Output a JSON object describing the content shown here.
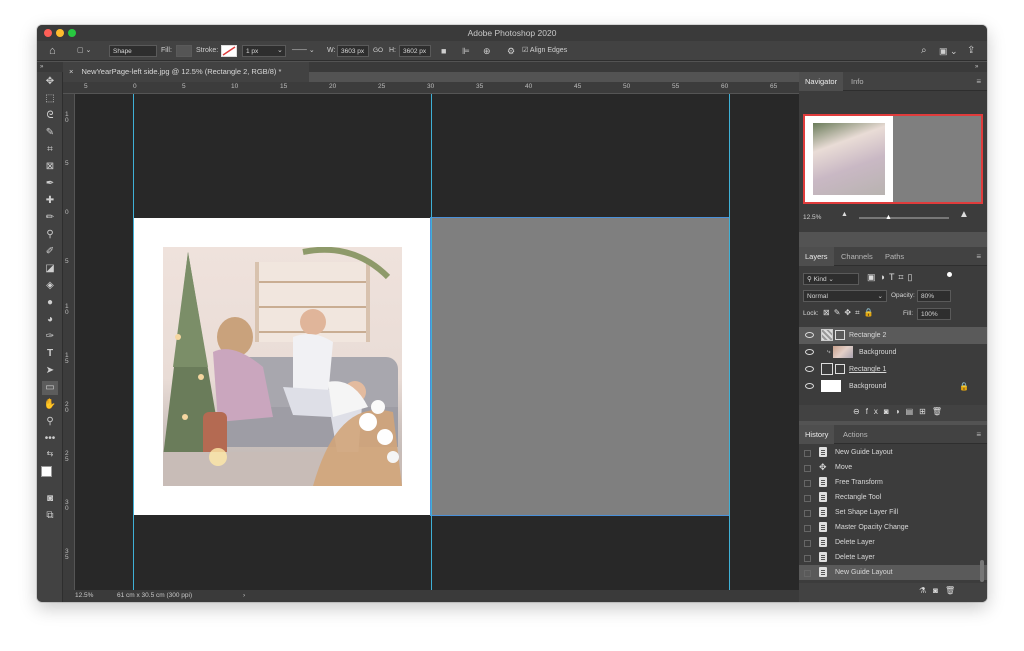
{
  "app": {
    "title": "Adobe Photoshop 2020"
  },
  "colors": {
    "guide": "#3fb0d6",
    "selection": "#4a90d9",
    "panel_bg": "#3c3c3c",
    "canvas_gray": "#7f7f7f",
    "pasteboard": "#282828",
    "nav_frame": "#e03c3c"
  },
  "options_bar": {
    "mode": "Shape",
    "fill_label": "Fill:",
    "stroke_label": "Stroke:",
    "stroke_width": "1 px",
    "w_label": "W:",
    "w_value": "3603 px",
    "link_glyph": "GO",
    "h_label": "H:",
    "h_value": "3602 px",
    "align_edges": "Align Edges"
  },
  "document": {
    "tab_title": "NewYearPage-left side.jpg @ 12.5% (Rectangle 2, RGB/8) *",
    "ruler_h": [
      "5",
      "0",
      "5",
      "10",
      "15",
      "20",
      "25",
      "30",
      "35",
      "40",
      "45",
      "50",
      "55",
      "60",
      "65"
    ],
    "ruler_v": [
      "1\n0",
      "5",
      "0",
      "5",
      "1\n0",
      "1\n5",
      "2\n0",
      "2\n5",
      "3\n0",
      "3\n5"
    ],
    "zoom": "12.5%",
    "doc_size": "61 cm x 30.5 cm (300 ppi)"
  },
  "navigator": {
    "tabs": [
      "Navigator",
      "Info"
    ],
    "zoom": "12.5%"
  },
  "layers": {
    "tabs": [
      "Layers",
      "Channels",
      "Paths"
    ],
    "filter": "Kind",
    "blend_mode": "Normal",
    "opacity_label": "Opacity:",
    "opacity": "80%",
    "lock_label": "Lock:",
    "fill_label": "Fill:",
    "fill": "100%",
    "items": [
      {
        "name": "Rectangle 2",
        "selected": true
      },
      {
        "name": "Background",
        "selected": false
      },
      {
        "name": "Rectangle 1",
        "selected": false
      },
      {
        "name": "Background",
        "selected": false
      }
    ]
  },
  "history": {
    "tabs": [
      "History",
      "Actions"
    ],
    "items": [
      "New Guide Layout",
      "Move",
      "Free Transform",
      "Rectangle Tool",
      "Set Shape Layer Fill",
      "Master Opacity Change",
      "Delete Layer",
      "Delete Layer",
      "New Guide Layout"
    ]
  }
}
